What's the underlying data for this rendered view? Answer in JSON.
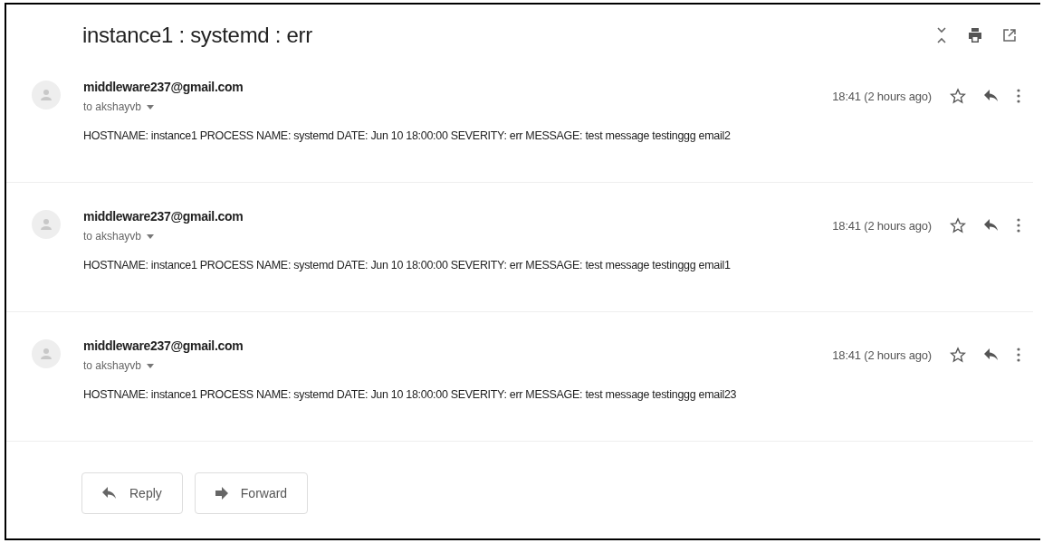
{
  "subject": "instance1 : systemd : err",
  "messages": [
    {
      "sender": "middleware237@gmail.com",
      "recipient": "to akshayvb",
      "time": "18:41 (2 hours ago)",
      "body": "HOSTNAME: instance1 PROCESS NAME: systemd DATE: Jun 10 18:00:00 SEVERITY: err MESSAGE: test message testinggg email2"
    },
    {
      "sender": "middleware237@gmail.com",
      "recipient": "to akshayvb",
      "time": "18:41 (2 hours ago)",
      "body": "HOSTNAME: instance1 PROCESS NAME: systemd DATE: Jun 10 18:00:00 SEVERITY: err MESSAGE: test message testinggg email1"
    },
    {
      "sender": "middleware237@gmail.com",
      "recipient": "to akshayvb",
      "time": "18:41 (2 hours ago)",
      "body": "HOSTNAME: instance1 PROCESS NAME: systemd DATE: Jun 10 18:00:00 SEVERITY: err MESSAGE: test message testinggg email23"
    }
  ],
  "actions": [
    {
      "kind": "reply",
      "label": "Reply"
    },
    {
      "kind": "forward",
      "label": "Forward"
    }
  ]
}
